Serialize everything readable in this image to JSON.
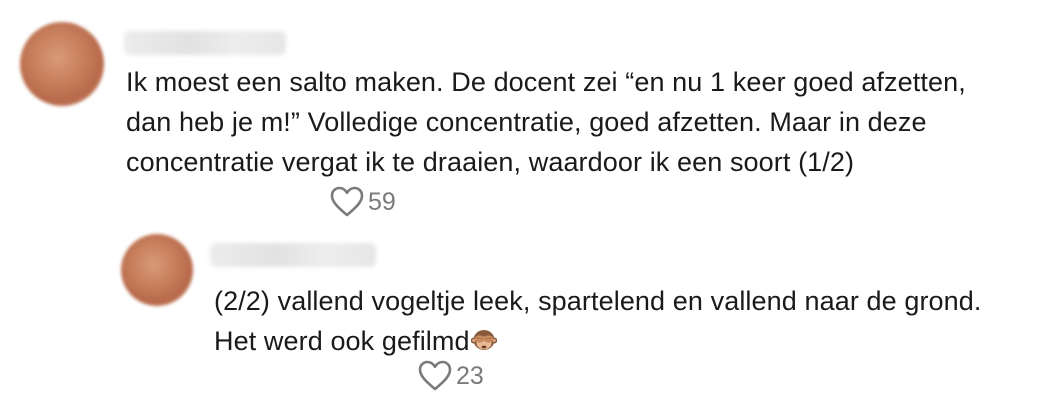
{
  "comments": [
    {
      "text": "Ik moest een salto maken. De docent zei “en nu 1 keer goed afzetten,\ndan heb je m!” Volledige concentratie, goed afzetten. Maar in deze\nconcentratie vergat ik te draaien, waardoor ik een soort (1/2)",
      "likes": "59"
    },
    {
      "text": "(2/2) vallend vogeltje leek, spartelend en vallend naar de grond.\nHet werd ook gefilmd",
      "emoji": "see-no-evil-monkey-icon",
      "likes": "23"
    }
  ],
  "colors": {
    "text": "#1a1a1a",
    "muted": "#7a7a7a",
    "background": "#ffffff"
  }
}
